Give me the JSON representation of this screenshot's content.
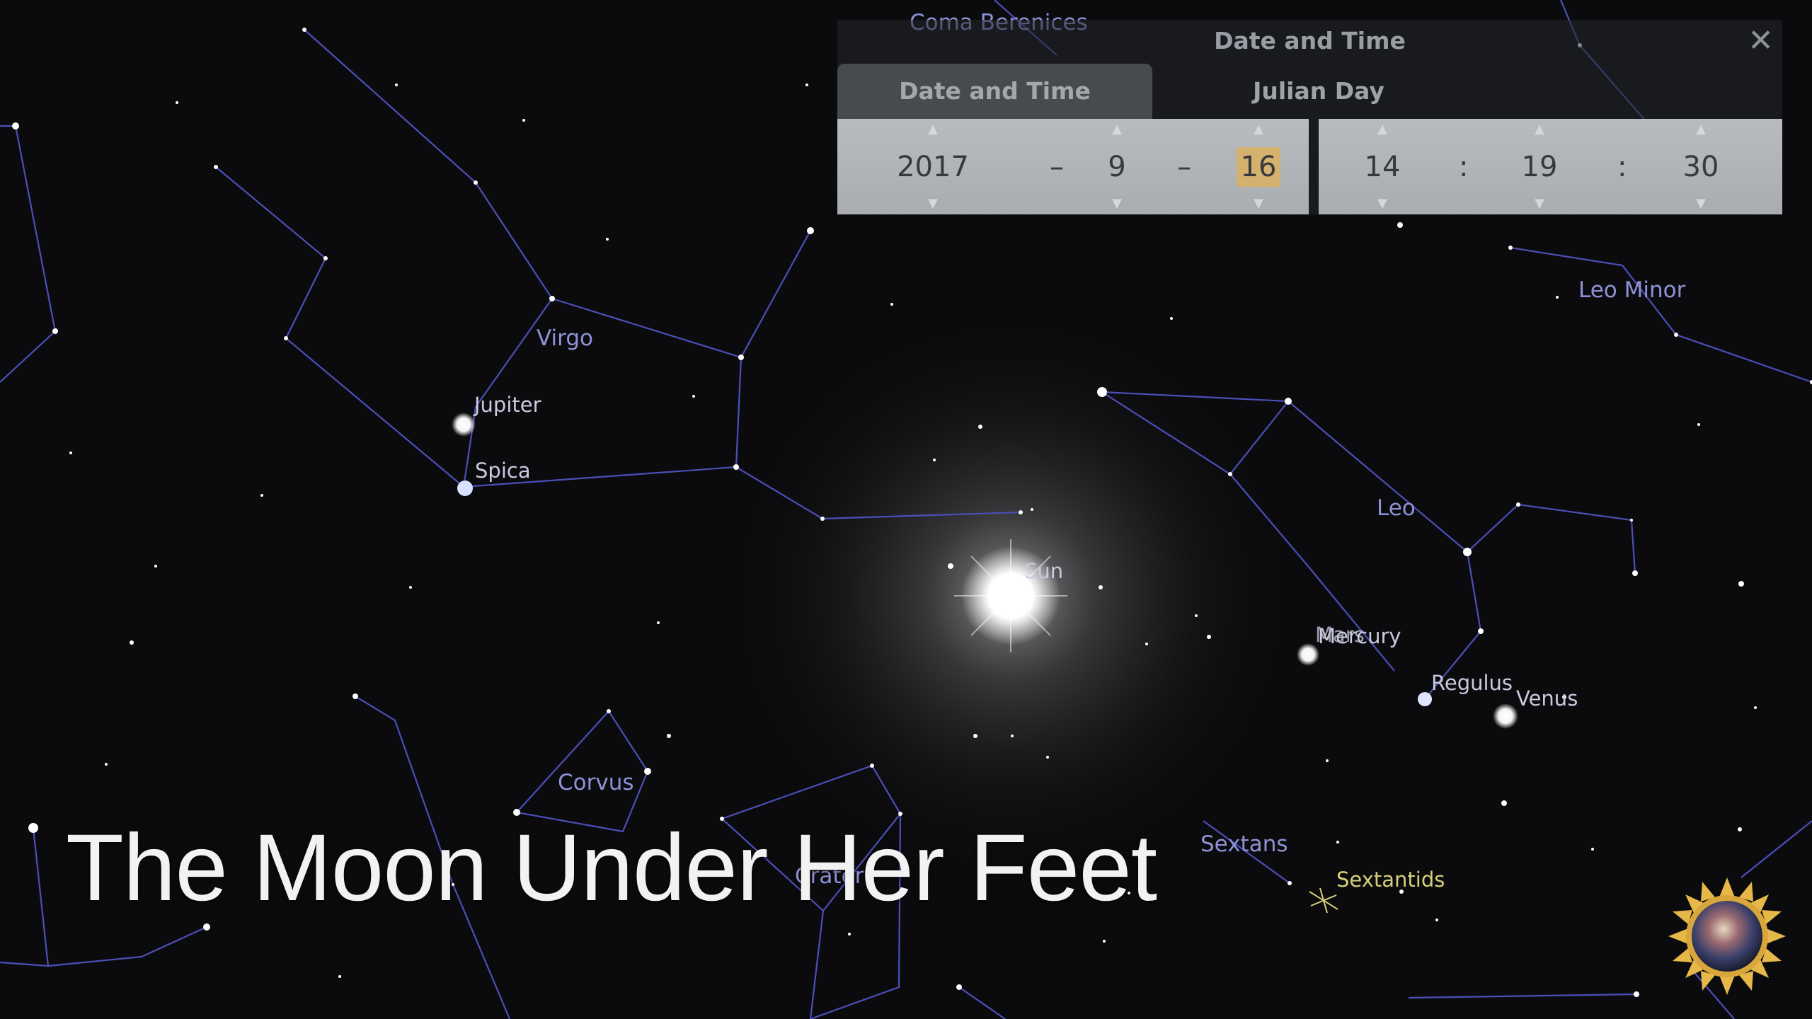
{
  "slide_title": "The Moon Under Her Feet",
  "constellations": {
    "coma_berenices": "Coma Berenices",
    "virgo": "Virgo",
    "leo": "Leo",
    "leo_minor": "Leo Minor",
    "corvus": "Corvus",
    "crater": "Crater",
    "sextans": "Sextans"
  },
  "objects": {
    "jupiter": "Jupiter",
    "spica": "Spica",
    "sun": "Sun",
    "mars": "Mars",
    "mercury": "Mercury",
    "regulus": "Regulus",
    "venus": "Venus"
  },
  "meteor_shower": "Sextantids",
  "date_time_window": {
    "title": "Date and Time",
    "close_glyph": "✕",
    "tabs": [
      "Date and Time",
      "Julian Day"
    ],
    "date": {
      "year": "2017",
      "month": "9",
      "day": "16",
      "separator": "–"
    },
    "time": {
      "hour": "14",
      "minute": "19",
      "second": "30",
      "separator": ":"
    }
  },
  "colors": {
    "constellation_line": "#4b4fb8",
    "constellation_label": "#8f92d6",
    "highlight_field": "#d4b16f",
    "meteor_label": "#d6d07a"
  }
}
